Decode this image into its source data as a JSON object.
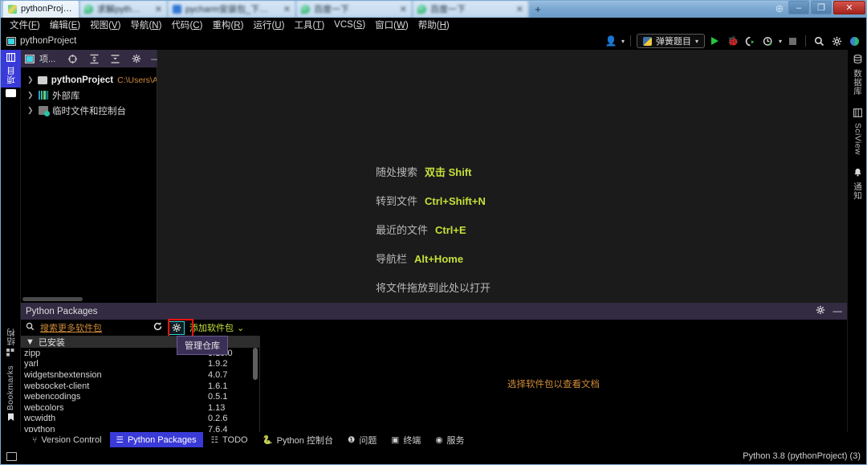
{
  "os_window": {
    "tabs": [
      {
        "label": "pythonProject",
        "favicon": "pycharm-icon",
        "active": true,
        "blurred": false
      },
      {
        "label": "求解python - 搜索",
        "favicon": "chrome-icon",
        "active": false,
        "blurred": true
      },
      {
        "label": "pycharm安装包_下载安装",
        "favicon": "chrome-blue-icon",
        "active": false,
        "blurred": true
      },
      {
        "label": "百度一下",
        "favicon": "drop-icon",
        "active": false,
        "blurred": true
      },
      {
        "label": "百度一下",
        "favicon": "drop-icon",
        "active": false,
        "blurred": true
      }
    ],
    "new_tab_label": "+",
    "controls": {
      "minimize": "–",
      "maximize": "❐",
      "close": "✕"
    }
  },
  "menubar": {
    "items": [
      {
        "text": "文件",
        "mnemonic": "F"
      },
      {
        "text": "编辑",
        "mnemonic": "E"
      },
      {
        "text": "视图",
        "mnemonic": "V"
      },
      {
        "text": "导航",
        "mnemonic": "N"
      },
      {
        "text": "代码",
        "mnemonic": "C"
      },
      {
        "text": "重构",
        "mnemonic": "R"
      },
      {
        "text": "运行",
        "mnemonic": "U"
      },
      {
        "text": "工具",
        "mnemonic": "T"
      },
      {
        "text": "VCS",
        "mnemonic": "S"
      },
      {
        "text": "窗口",
        "mnemonic": "W"
      },
      {
        "text": "帮助",
        "mnemonic": "H"
      }
    ]
  },
  "toolbar": {
    "project_name": "pythonProject",
    "run_config": "弹簧题目",
    "icons": {
      "account": "person-icon",
      "run": "run-icon",
      "debug": "bug-icon",
      "coverage": "coverage-icon",
      "profile": "profiler-icon",
      "stop": "stop-icon",
      "search": "search-icon",
      "settings": "gear-icon",
      "ai": "ai-assistant-icon"
    }
  },
  "left_strip": {
    "top": [
      {
        "label": "项目",
        "icon": "project-icon",
        "active": true
      }
    ],
    "bottom": [
      {
        "label": "Bookmarks",
        "icon": "bookmark-icon"
      },
      {
        "label": "结构",
        "icon": "structure-icon"
      }
    ]
  },
  "right_strip": {
    "items": [
      {
        "label": "数据库",
        "icon": "database-icon"
      },
      {
        "label": "SciView",
        "icon": "sciview-icon"
      },
      {
        "label": "通知",
        "icon": "bell-icon"
      }
    ]
  },
  "project_panel": {
    "title": "项...",
    "header_icons": [
      "project-view-icon",
      "locate-icon",
      "expand-all-icon",
      "collapse-all-icon",
      "gear-icon",
      "minimize-icon"
    ],
    "tree": [
      {
        "name": "pythonProject",
        "path": "C:\\Users\\Ad",
        "icon": "folder-icon",
        "bold": true,
        "expanded": false
      },
      {
        "name": "外部库",
        "path": "",
        "icon": "library-icon",
        "bold": false,
        "expanded": false
      },
      {
        "name": "临时文件和控制台",
        "path": "",
        "icon": "scratch-icon",
        "bold": false,
        "expanded": false
      }
    ]
  },
  "editor": {
    "hints": [
      {
        "label": "随处搜索",
        "key": "双击 Shift"
      },
      {
        "label": "转到文件",
        "key": "Ctrl+Shift+N"
      },
      {
        "label": "最近的文件",
        "key": "Ctrl+E"
      },
      {
        "label": "导航栏",
        "key": "Alt+Home"
      },
      {
        "label": "将文件拖放到此处以打开",
        "key": ""
      }
    ]
  },
  "packages_panel": {
    "title": "Python Packages",
    "header_icons": [
      "gear-icon",
      "minimize-icon"
    ],
    "search_placeholder": "搜索更多软件包",
    "refresh_icon": "refresh-icon",
    "manage_repos_icon": "gear-icon",
    "add_package_label": "添加软件包",
    "tooltip": "管理仓库",
    "installed_label": "已安装",
    "doc_placeholder": "选择软件包以查看文档",
    "packages": [
      {
        "name": "zipp",
        "version": "3.15.0"
      },
      {
        "name": "yarl",
        "version": "1.9.2"
      },
      {
        "name": "widgetsnbextension",
        "version": "4.0.7"
      },
      {
        "name": "websocket-client",
        "version": "1.6.1"
      },
      {
        "name": "webencodings",
        "version": "0.5.1"
      },
      {
        "name": "webcolors",
        "version": "1.13"
      },
      {
        "name": "wcwidth",
        "version": "0.2.6"
      },
      {
        "name": "vpython",
        "version": "7.6.4"
      }
    ]
  },
  "bottom_tabs": [
    {
      "label": "Version Control",
      "icon": "branch-icon",
      "active": false
    },
    {
      "label": "Python Packages",
      "icon": "packages-icon",
      "active": true
    },
    {
      "label": "TODO",
      "icon": "todo-icon",
      "active": false
    },
    {
      "label": "Python 控制台",
      "icon": "python-icon",
      "active": false
    },
    {
      "label": "问题",
      "icon": "problems-icon",
      "active": false
    },
    {
      "label": "终端",
      "icon": "terminal-icon",
      "active": false
    },
    {
      "label": "服务",
      "icon": "services-icon",
      "active": false
    }
  ],
  "statusbar": {
    "left_icon": "event-log-icon",
    "interpreter": "Python 3.8 (pythonProject) (3)"
  },
  "colors": {
    "accent_blue": "#3a3ad8",
    "panel_header": "#322b42",
    "hint_key": "#c5e03a",
    "orange_link": "#cf8b3a",
    "highlight_red": "#ee1111",
    "highlight_cyan": "#2ad2e0"
  }
}
